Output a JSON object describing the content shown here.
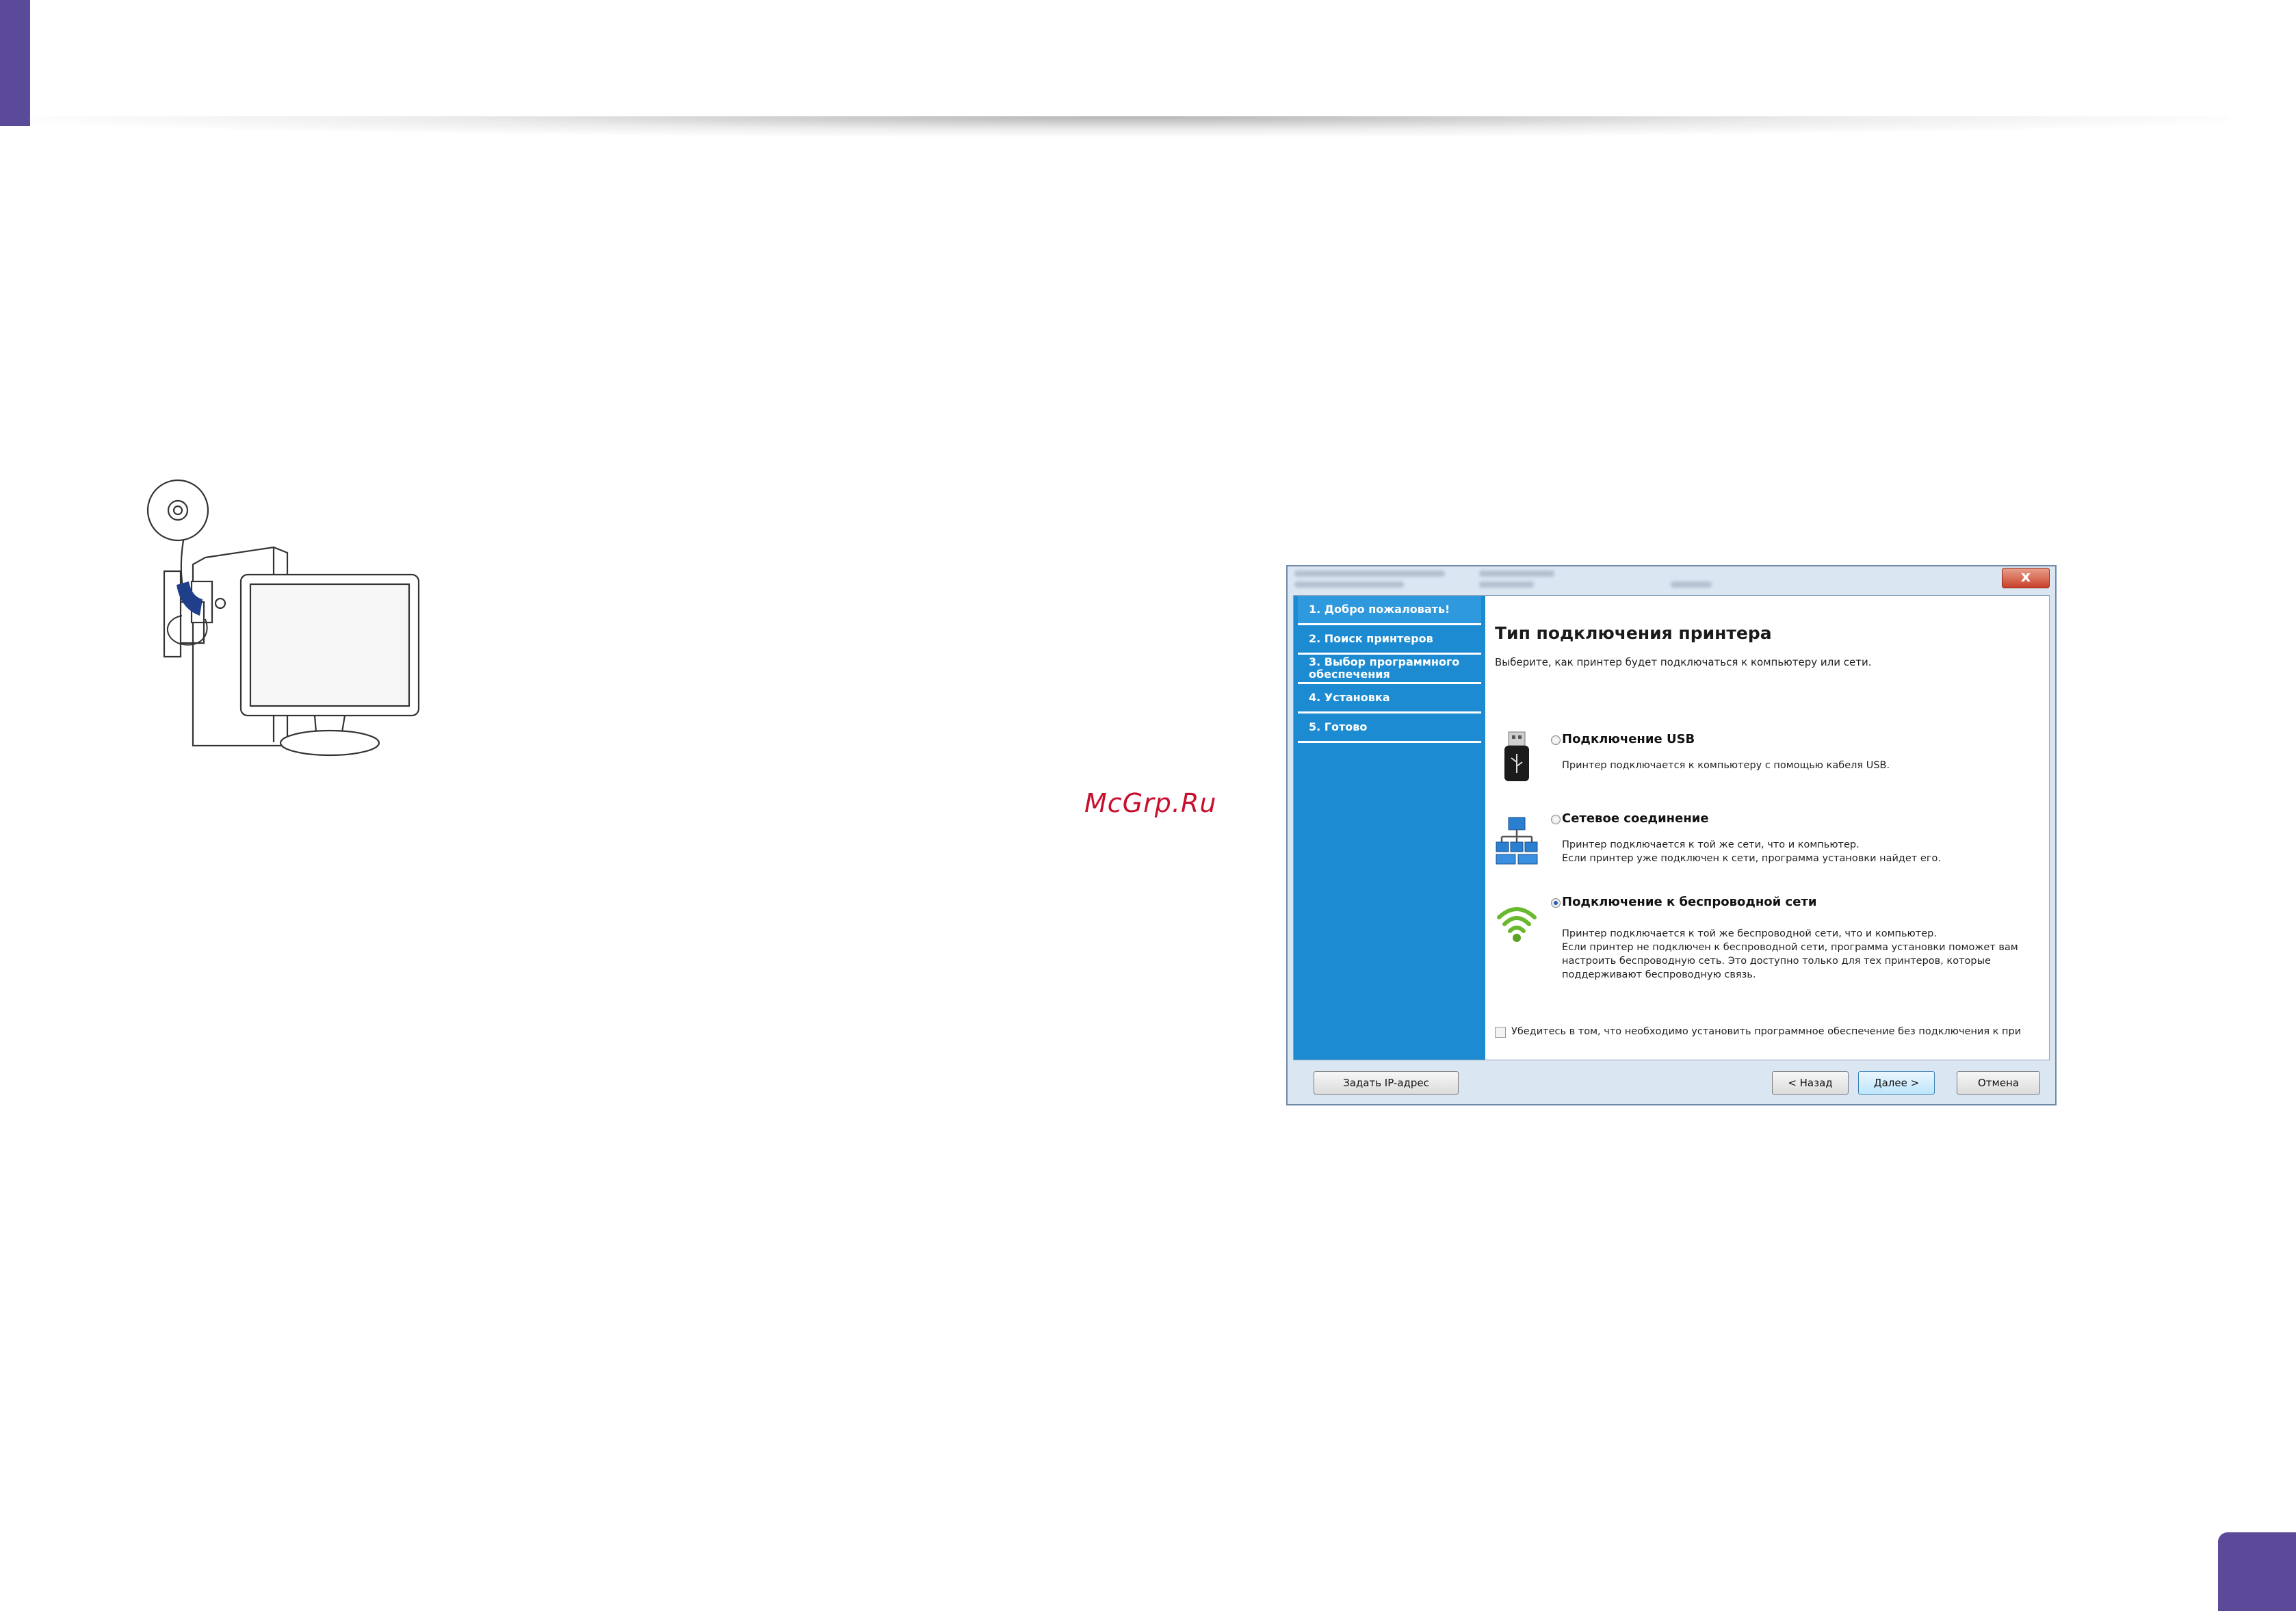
{
  "watermark": "McGrp.Ru",
  "installer": {
    "steps": [
      {
        "label": "1. Добро пожаловать!"
      },
      {
        "label": "2. Поиск принтеров"
      },
      {
        "label": "3. Выбор программного обеспечения"
      },
      {
        "label": "4. Установка"
      },
      {
        "label": "5. Готово"
      }
    ],
    "title": "Тип подключения принтера",
    "subtitle": "Выберите, как принтер будет подключаться к компьютеру или сети.",
    "options": [
      {
        "icon": "usb-drive-icon",
        "title": "Подключение USB",
        "desc": [
          "Принтер подключается к компьютеру с помощью кабеля USB."
        ],
        "selected": false
      },
      {
        "icon": "network-icon",
        "title": "Сетевое соединение",
        "desc": [
          "Принтер подключается к той же сети, что и компьютер.",
          "Если принтер уже подключен к сети, программа установки найдет его."
        ],
        "selected": false
      },
      {
        "icon": "wifi-icon",
        "title": "Подключение к беспроводной сети",
        "desc": [
          "Принтер подключается к той же беспроводной сети, что и компьютер.",
          "Если принтер не подключен к беспроводной сети, программа установки поможет вам",
          "настроить беспроводную сеть. Это доступно только для тех принтеров, которые",
          "поддерживают беспроводную связь."
        ],
        "selected": true
      }
    ],
    "checkbox_label": "Убедитесь в том, что необходимо установить программное обеспечение без подключения к при",
    "checkbox_checked": false,
    "buttons": {
      "set_ip": "Задать IP-адрес",
      "back": "< Назад",
      "next": "Далее >",
      "cancel": "Отмена"
    },
    "close_symbol": "x"
  },
  "colors": {
    "accent": "#5b4a9a",
    "sidebar": "#1d8bd1",
    "watermark": "#c8102e"
  }
}
